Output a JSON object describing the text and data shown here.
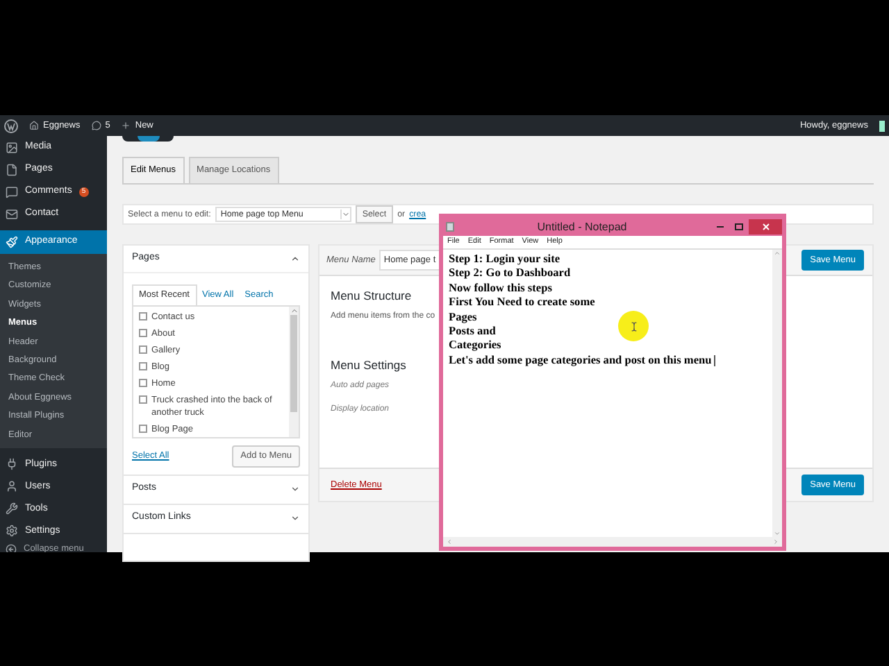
{
  "admin_bar": {
    "site": "Eggnews",
    "comments": "5",
    "new": "New",
    "greeting": "Howdy, eggnews"
  },
  "sidebar": {
    "items": [
      {
        "label": "Media",
        "selected": false
      },
      {
        "label": "Pages",
        "selected": false
      },
      {
        "label": "Comments",
        "selected": false,
        "badge": "5"
      },
      {
        "label": "Contact",
        "selected": false
      },
      {
        "label": "Appearance",
        "selected": true,
        "children": [
          {
            "label": "Themes",
            "selected": false
          },
          {
            "label": "Customize",
            "selected": false
          },
          {
            "label": "Widgets",
            "selected": false
          },
          {
            "label": "Menus",
            "selected": true
          },
          {
            "label": "Header",
            "selected": false
          },
          {
            "label": "Background",
            "selected": false
          },
          {
            "label": "Theme Check",
            "selected": false
          },
          {
            "label": "About Eggnews",
            "selected": false
          },
          {
            "label": "Install Plugins",
            "selected": false
          },
          {
            "label": "Editor",
            "selected": false
          }
        ]
      },
      {
        "label": "Plugins",
        "selected": false
      },
      {
        "label": "Users",
        "selected": false
      },
      {
        "label": "Tools",
        "selected": false
      },
      {
        "label": "Settings",
        "selected": false
      }
    ],
    "collapse": "Collapse menu"
  },
  "tabs": [
    {
      "label": "Edit Menus",
      "selected": true
    },
    {
      "label": "Manage Locations",
      "selected": false
    }
  ],
  "menu_select": {
    "label": "Select a menu to edit:",
    "value": "Home page top Menu",
    "button": "Select",
    "or": "or",
    "link": "crea"
  },
  "pages_box": {
    "title": "Pages",
    "tabs": [
      {
        "label": "Most Recent",
        "selected": true
      },
      {
        "label": "View All",
        "selected": false
      },
      {
        "label": "Search",
        "selected": false
      }
    ],
    "items": [
      {
        "label": "Contact us",
        "checked": false
      },
      {
        "label": "About",
        "checked": false
      },
      {
        "label": "Gallery",
        "checked": false
      },
      {
        "label": "Blog",
        "checked": false
      },
      {
        "label": "Home",
        "checked": false
      },
      {
        "label": "Truck crashed into the back of another truck",
        "checked": false
      },
      {
        "label": "Blog Page",
        "checked": false
      }
    ],
    "select_all": "Select All",
    "add_button": "Add to Menu"
  },
  "accordions": [
    {
      "label": "Posts",
      "expanded": false
    },
    {
      "label": "Custom Links",
      "expanded": false
    }
  ],
  "menu_editor": {
    "name_label": "Menu Name",
    "name_value": "Home page t",
    "save": "Save Menu",
    "structure_title": "Menu Structure",
    "structure_hint": "Add menu items from the co",
    "settings_title": "Menu Settings",
    "auto_add": "Auto add pages",
    "display_location": "Display location",
    "delete": "Delete Menu",
    "save_bottom": "Save Menu"
  },
  "notepad": {
    "title": "Untitled - Notepad",
    "menu": [
      "File",
      "Edit",
      "Format",
      "View",
      "Help"
    ],
    "lines": [
      "Step 1: Login your site",
      "Step 2: Go to Dashboard",
      "Now follow this steps",
      "First You Need to create some",
      "Pages",
      "Posts and",
      "Categories",
      "Let's add some page categories and post on this menu"
    ]
  }
}
